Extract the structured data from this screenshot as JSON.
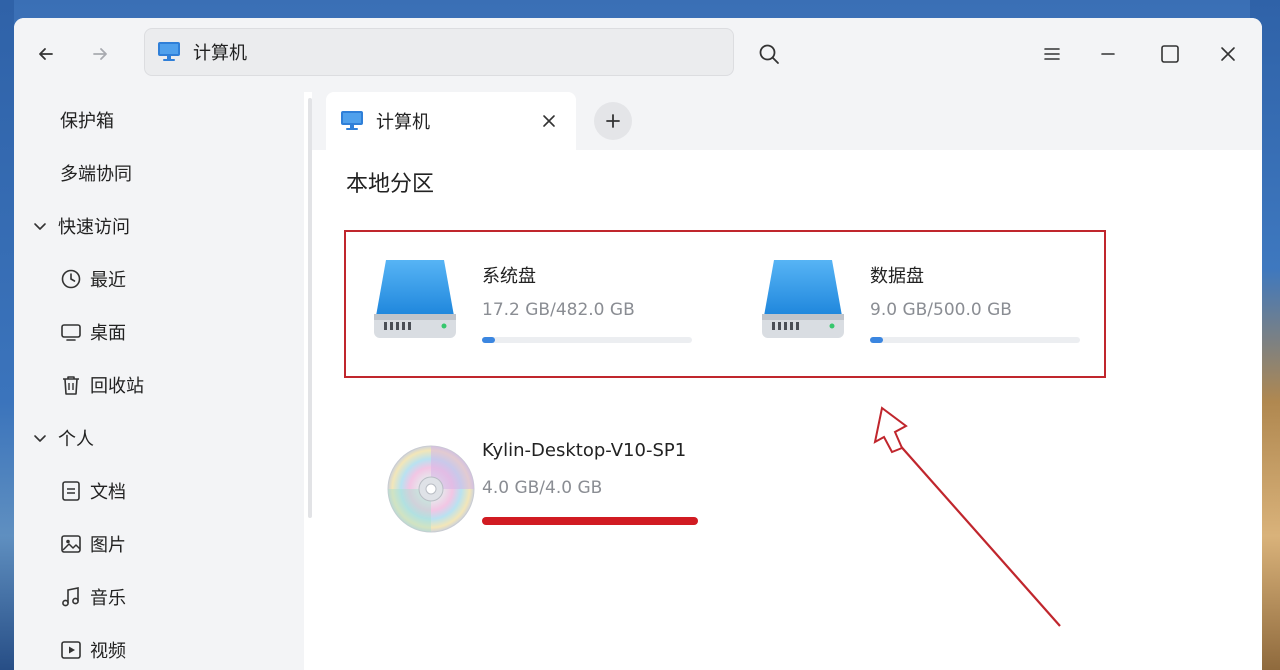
{
  "window": {
    "address": "计算机",
    "nav": {
      "back_icon": "arrow-left-icon",
      "forward_icon": "arrow-right-icon"
    }
  },
  "sidebar": {
    "items": [
      {
        "label": "保护箱",
        "icon": null
      },
      {
        "label": "多端协同",
        "icon": null
      },
      {
        "label": "快速访问",
        "group": true
      },
      {
        "label": "最近",
        "icon": "clock-icon"
      },
      {
        "label": "桌面",
        "icon": "monitor-icon"
      },
      {
        "label": "回收站",
        "icon": "trash-icon"
      },
      {
        "label": "个人",
        "group": true
      },
      {
        "label": "文档",
        "icon": "document-icon"
      },
      {
        "label": "图片",
        "icon": "image-icon"
      },
      {
        "label": "音乐",
        "icon": "music-icon"
      },
      {
        "label": "视频",
        "icon": "video-icon"
      }
    ]
  },
  "tabs": [
    {
      "label": "计算机"
    }
  ],
  "main": {
    "section_title": "本地分区",
    "drives": [
      {
        "name": "系统盘",
        "size": "17.2 GB/482.0 GB",
        "used_fraction": 0.036
      },
      {
        "name": "数据盘",
        "size": "9.0 GB/500.0 GB",
        "used_fraction": 0.018
      }
    ],
    "disc": {
      "name": "Kylin-Desktop-V10-SP1",
      "size": "4.0 GB/4.0 GB",
      "used_fraction": 1.0
    }
  },
  "colors": {
    "accent": "#3b86e0",
    "highlight": "#c0262d",
    "disc_bar": "#d11b22"
  }
}
